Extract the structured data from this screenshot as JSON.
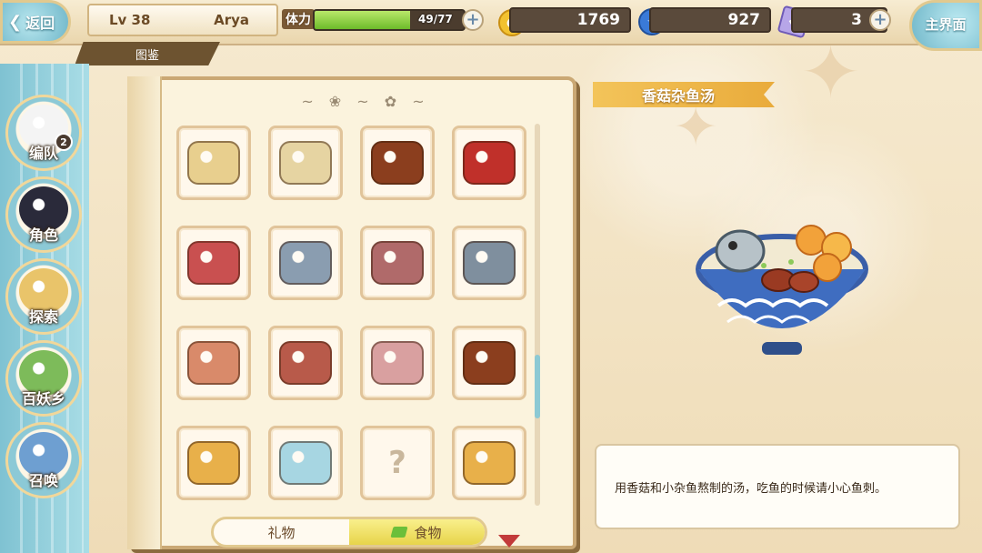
{
  "topbar": {
    "back_label": "返回",
    "level": "Lv 38",
    "player_name": "Arya",
    "stamina_label": "体力",
    "stamina_value": "49/77",
    "stamina_fraction": 0.64,
    "gold": "1769",
    "soul": "927",
    "crystal": "3",
    "main_label": "主界面",
    "book_title": "图鉴"
  },
  "nav": [
    {
      "label": "编队",
      "badge": "2",
      "color": "#f4f4f4"
    },
    {
      "label": "角色",
      "color": "#2a2a3a"
    },
    {
      "label": "探索",
      "color": "#e9c46a"
    },
    {
      "label": "百妖乡",
      "color": "#7dbb5a"
    },
    {
      "label": "召唤",
      "color": "#6e9fd1"
    }
  ],
  "grid": {
    "items": [
      {
        "icon": "pastry-bag-icon",
        "color": "#e8cf8e"
      },
      {
        "icon": "pastry-bag-icon",
        "color": "#e6d4a2"
      },
      {
        "icon": "braised-meat-icon",
        "color": "#8b3e1e"
      },
      {
        "icon": "red-meat-icon",
        "color": "#c0302a"
      },
      {
        "icon": "meat-bun-icon",
        "color": "#c95050"
      },
      {
        "icon": "small-fish-icon",
        "color": "#8a9db0"
      },
      {
        "icon": "grilled-fish-icon",
        "color": "#b06a6a"
      },
      {
        "icon": "small-fish-icon",
        "color": "#7f8f9e"
      },
      {
        "icon": "dried-fish-icon",
        "color": "#d98a6a"
      },
      {
        "icon": "dried-fish-icon",
        "color": "#b85a4a"
      },
      {
        "icon": "salted-fish-icon",
        "color": "#d9a0a0"
      },
      {
        "icon": "braised-egg-icon",
        "color": "#8b3e1e"
      },
      {
        "icon": "egg-set-icon",
        "color": "#e8b04a"
      },
      {
        "icon": "salted-egg-icon",
        "color": "#a7d6e2"
      },
      {
        "icon": "unknown-icon",
        "color": "#c9b79c"
      },
      {
        "icon": "egg-set-icon",
        "color": "#e8b04a"
      }
    ]
  },
  "tabs": {
    "gift_label": "礼物",
    "food_label": "食物"
  },
  "detail": {
    "title": "香菇杂鱼汤",
    "description": "用香菇和小杂鱼熬制的汤，吃鱼的时候请小心鱼刺。"
  }
}
